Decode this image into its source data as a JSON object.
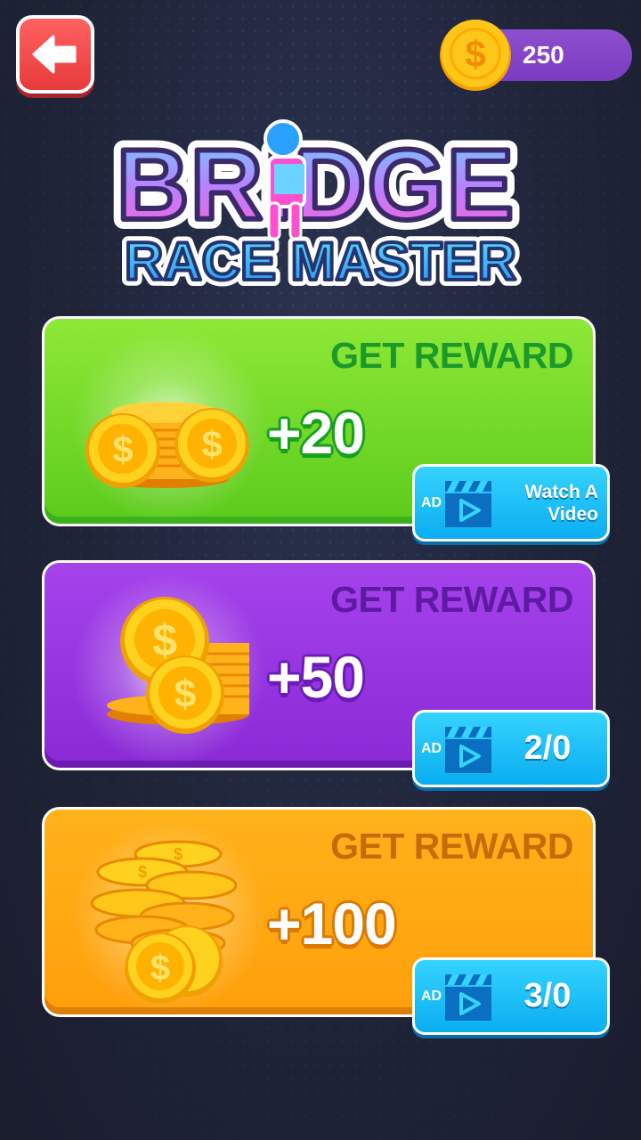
{
  "header": {
    "back_icon": "arrow-left-icon",
    "coin_icon": "dollar-coin-icon",
    "coin_balance": "250"
  },
  "logo": {
    "title": "BRIDGE",
    "subtitle": "RACE MASTER"
  },
  "rewards": [
    {
      "title": "GET REWARD",
      "amount": "+20",
      "ad_tag": "AD",
      "button_label": "Watch A\nVideo",
      "theme": {
        "bg_top": "#8ee837",
        "bg_bottom": "#5ccb1c",
        "title_color": "#1b9a2a",
        "amount_stroke": "#16a01f",
        "base": "#3bb21c"
      }
    },
    {
      "title": "GET REWARD",
      "amount": "+50",
      "ad_tag": "AD",
      "button_label": "2/0",
      "theme": {
        "bg_top": "#a542ec",
        "bg_bottom": "#8a2ad6",
        "title_color": "#5e1aa3",
        "amount_stroke": "#6a1cb8",
        "base": "#6b1bb0"
      }
    },
    {
      "title": "GET REWARD",
      "amount": "+100",
      "ad_tag": "AD",
      "button_label": "3/0",
      "theme": {
        "bg_top": "#ffb21a",
        "bg_bottom": "#ff9f0a",
        "title_color": "#c86a08",
        "amount_stroke": "#d97a06",
        "base": "#dc7f05"
      }
    }
  ],
  "colors": {
    "background": "#1f2438",
    "back_button": "#e83b3b",
    "coin_pill": "#7a3bbf",
    "ad_button": "#0aaef0"
  }
}
